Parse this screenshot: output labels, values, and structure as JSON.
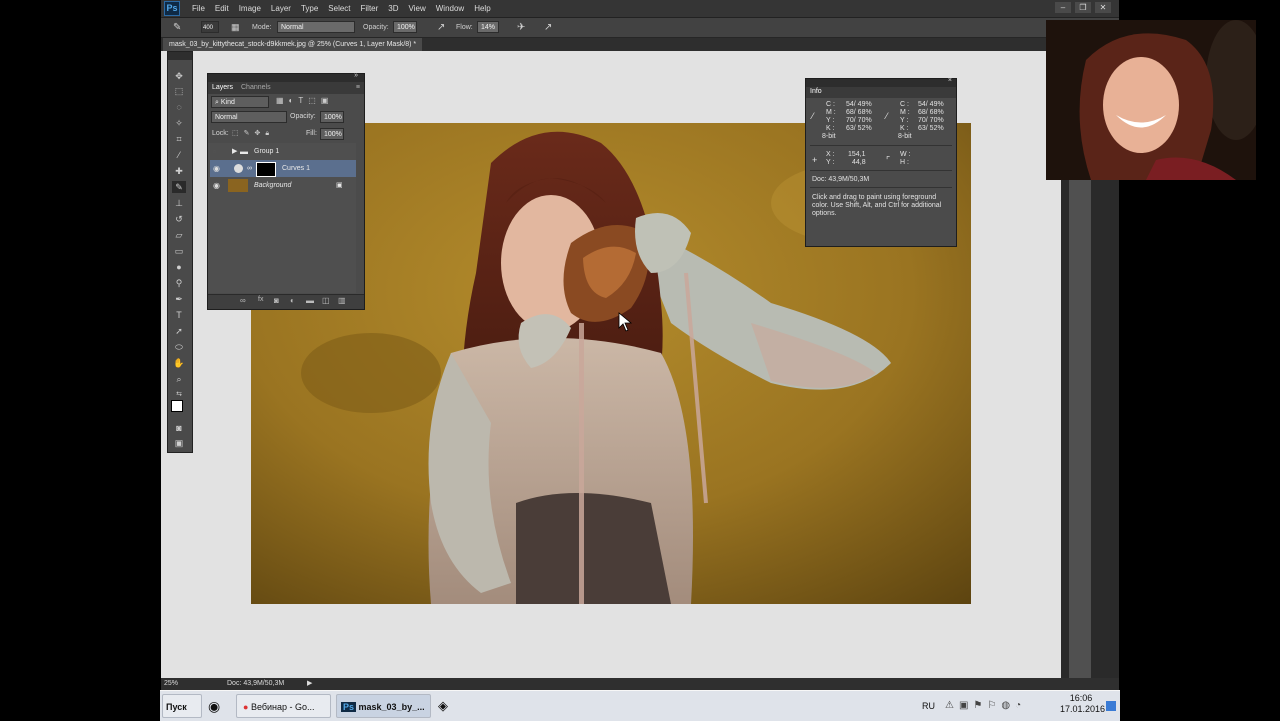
{
  "app": {
    "logo": "Ps",
    "menu": [
      "File",
      "Edit",
      "Image",
      "Layer",
      "Type",
      "Select",
      "Filter",
      "3D",
      "View",
      "Window",
      "Help"
    ],
    "window_controls": [
      "–",
      "❐",
      "✕"
    ]
  },
  "options_bar": {
    "brush_size": "400",
    "mode_label": "Mode:",
    "mode_value": "Normal",
    "opacity_label": "Opacity:",
    "opacity_value": "100%",
    "flow_label": "Flow:",
    "flow_value": "14%"
  },
  "document_tab": "mask_03_by_kittythecat_stock-d9kkmek.jpg @ 25% (Curves 1, Layer Mask/8) *",
  "status_bar": {
    "zoom": "25%",
    "doc": "Doc: 43,9M/50,3M"
  },
  "layers_panel": {
    "tabs": [
      "Layers",
      "Channels"
    ],
    "filter_label": "Kind",
    "blend_mode": "Normal",
    "opacity_label": "Opacity:",
    "opacity_value": "100%",
    "lock_label": "Lock:",
    "fill_label": "Fill:",
    "fill_value": "100%",
    "layers": [
      {
        "name": "Group 1",
        "visible": false,
        "selected": false,
        "type": "group"
      },
      {
        "name": "Curves 1",
        "visible": true,
        "selected": true,
        "type": "adjustment"
      },
      {
        "name": "Background",
        "visible": true,
        "selected": false,
        "type": "background",
        "locked": true
      }
    ],
    "footer_icons": [
      "link-icon",
      "fx-icon",
      "mask-icon",
      "adjustment-icon",
      "folder-icon",
      "new-layer-icon",
      "trash-icon"
    ]
  },
  "info_panel": {
    "tab": "Info",
    "left_cmyk": {
      "C": "54/  49%",
      "M": "68/  68%",
      "Y": "70/  70%",
      "K": "63/  52%",
      "bits": "8-bit"
    },
    "right_cmyk": {
      "C": "54/  49%",
      "M": "68/  68%",
      "Y": "70/  70%",
      "K": "63/  52%",
      "bits": "8-bit"
    },
    "x_label": "X :",
    "x_value": "154,1",
    "y_label": "Y :",
    "y_value": "44,8",
    "w_label": "W :",
    "h_label": "H :",
    "doc": "Doc: 43,9M/50,3M",
    "hint": "Click and drag to paint using foreground color. Use Shift, Alt, and Ctrl for additional options."
  },
  "taskbar": {
    "start": "Пуск",
    "buttons": [
      {
        "label": "Вебинар - Go..."
      },
      {
        "label": "mask_03_by_..."
      }
    ],
    "lang": "RU",
    "time": "16:06",
    "date": "17.01.2016"
  },
  "colors": {
    "ps_bg": "#3c3c3c",
    "canvas_bg": "#e2e2e2",
    "selected_layer": "#5b6f8e",
    "photo_wall": "#9a7421"
  }
}
